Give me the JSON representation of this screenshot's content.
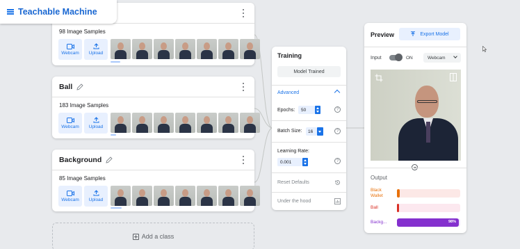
{
  "app": {
    "title": "Teachable Machine"
  },
  "classes": [
    {
      "name": "",
      "samples": "98 Image Samples",
      "webcam": "Webcam",
      "upload": "Upload"
    },
    {
      "name": "Ball",
      "samples": "183 Image Samples",
      "webcam": "Webcam",
      "upload": "Upload"
    },
    {
      "name": "Background",
      "samples": "85 Image Samples",
      "webcam": "Webcam",
      "upload": "Upload"
    }
  ],
  "add_class": "Add a class",
  "training": {
    "title": "Training",
    "trained_button": "Model Trained",
    "advanced": "Advanced",
    "epochs_label": "Epochs:",
    "epochs_value": "50",
    "batch_label": "Batch Size:",
    "batch_value": "16",
    "lr_label": "Learning Rate:",
    "lr_value": "0.001",
    "reset": "Reset Defaults",
    "under_hood": "Under the hood",
    "help": "?"
  },
  "preview": {
    "title": "Preview",
    "export": "Export Model",
    "input_label": "Input",
    "toggle_state": "ON",
    "source": "Webcam",
    "output_title": "Output",
    "outputs": [
      {
        "label": "Black\nWallet",
        "value": 0.04,
        "percent": "",
        "color": "#e8710a",
        "track": "#fce8e6"
      },
      {
        "label": "Ball",
        "value": 0.02,
        "percent": "",
        "color": "#d93025",
        "track": "#fce8ef"
      },
      {
        "label": "Backg...",
        "value": 0.98,
        "percent": "98%",
        "color": "#8430ce",
        "track": "#f3e8fd"
      }
    ]
  }
}
